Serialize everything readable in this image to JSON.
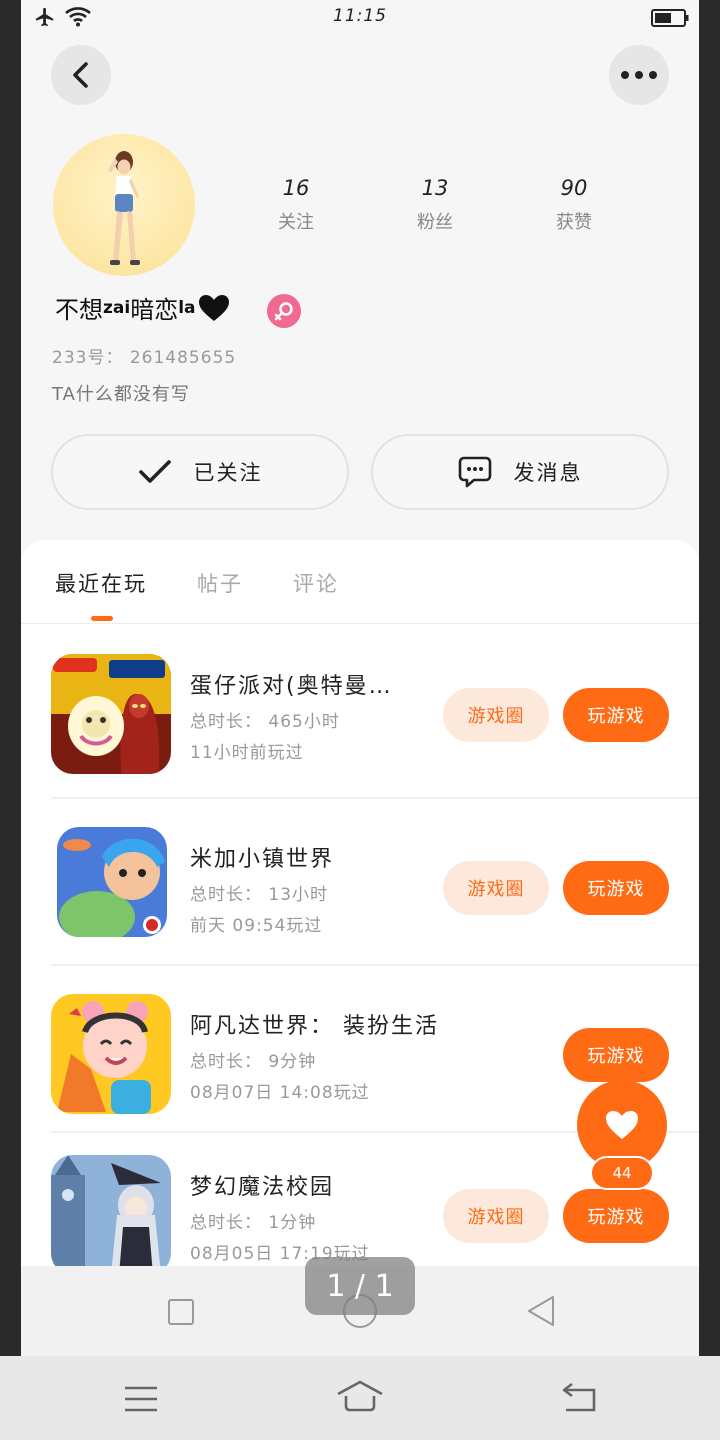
{
  "status_bar": {
    "time": "11:15"
  },
  "profile": {
    "stats": [
      {
        "value": "16",
        "label": "关注"
      },
      {
        "value": "13",
        "label": "粉丝"
      },
      {
        "value": "90",
        "label": "获赞"
      }
    ],
    "username_part1": "不想",
    "username_sup1": "zai",
    "username_part2": "暗恋",
    "username_sup2": "la",
    "user_id": "233号： 261485655",
    "bio": "TA什么都没有写"
  },
  "actions": {
    "follow_label": "已关注",
    "message_label": "发消息"
  },
  "tabs": [
    {
      "label": "最近在玩",
      "active": true
    },
    {
      "label": "帖子",
      "active": false
    },
    {
      "label": "评论",
      "active": false
    }
  ],
  "games": [
    {
      "name": "蛋仔派对(奥特曼…",
      "duration": "总时长： 465小时",
      "last_played": "11小时前玩过",
      "circle_label": "游戏圈",
      "play_label": "玩游戏",
      "icon_badge_top": "蛋仔派对",
      "icon_badge_right": "ULTRAMAN 奥特曼"
    },
    {
      "name": "米加小镇世界",
      "duration": "总时长： 13小时",
      "last_played": "前天 09:54玩过",
      "circle_label": "游戏圈",
      "play_label": "玩游戏"
    },
    {
      "name": "阿凡达世界： 装扮生活",
      "duration": "总时长： 9分钟",
      "last_played": "08月07日 14:08玩过",
      "play_label": "玩游戏"
    },
    {
      "name": "梦幻魔法校园",
      "duration": "总时长： 1分钟",
      "last_played": "08月05日 17:19玩过",
      "circle_label": "游戏圈",
      "play_label": "玩游戏"
    }
  ],
  "like": {
    "count": "44"
  },
  "page_indicator": "1 / 1",
  "colors": {
    "accent": "#ff6a14",
    "accent_light": "#fde9dc",
    "gender_badge": "#f06a92"
  },
  "icons": [
    "airplane-icon",
    "wifi-icon",
    "battery-icon",
    "back-arrow-icon",
    "more-icon",
    "check-icon",
    "chat-icon",
    "heart-icon",
    "square-nav-icon",
    "circle-nav-icon",
    "triangle-nav-icon",
    "menu-nav-icon",
    "home-nav-icon",
    "return-nav-icon"
  ]
}
